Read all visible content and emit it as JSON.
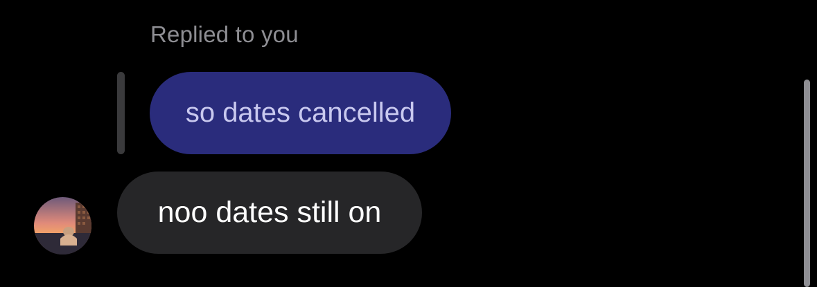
{
  "thread": {
    "reply_context_label": "Replied to you",
    "quoted_message": {
      "text": "so dates cancelled",
      "bubble_color": "#2a2c7c"
    },
    "message": {
      "text": "noo dates still on",
      "bubble_color": "#262628"
    },
    "avatar": {
      "icon": "profile-photo-avatar"
    }
  },
  "colors": {
    "background": "#000000",
    "reply_label": "#8e8e93",
    "quoted_text": "#c9c9ef",
    "message_text": "#ffffff"
  }
}
